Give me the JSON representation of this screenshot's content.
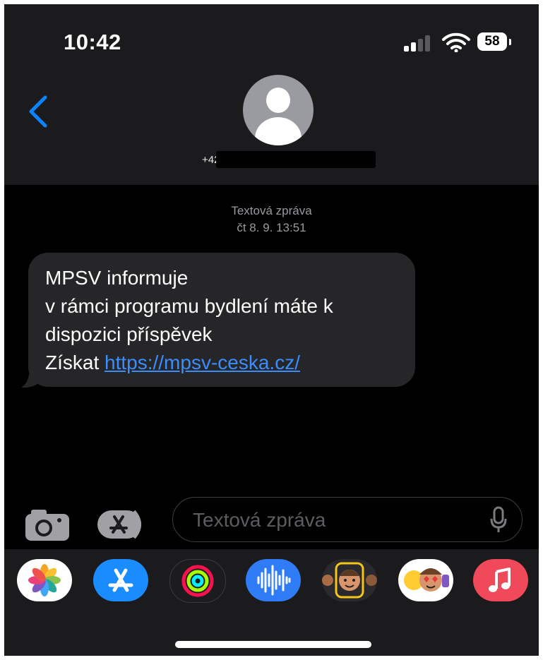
{
  "status_bar": {
    "time": "10:42",
    "battery": "58"
  },
  "contact": {
    "name": "+420"
  },
  "conversation": {
    "service_label": "Textová zpráva",
    "date": "čt 8. 9. 13:51",
    "message": {
      "lines": [
        "MPSV informuje",
        "v rámci programu bydlení máte k",
        "dispozici příspěvek"
      ],
      "link_prefix": "Získat ",
      "link": "https://mpsv-ceska.cz/"
    }
  },
  "compose": {
    "placeholder": "Textová zpráva"
  },
  "app_drawer": {
    "apps": [
      "photos-icon",
      "app-store-icon",
      "activity-icon",
      "audio-message-icon",
      "memoji-stickers-icon",
      "animoji-icon",
      "music-icon"
    ]
  },
  "colors": {
    "background": "#000000",
    "header": "#1b1b1d",
    "bubble": "#262628",
    "link": "#3a8dff",
    "accent": "#0a84ff"
  }
}
